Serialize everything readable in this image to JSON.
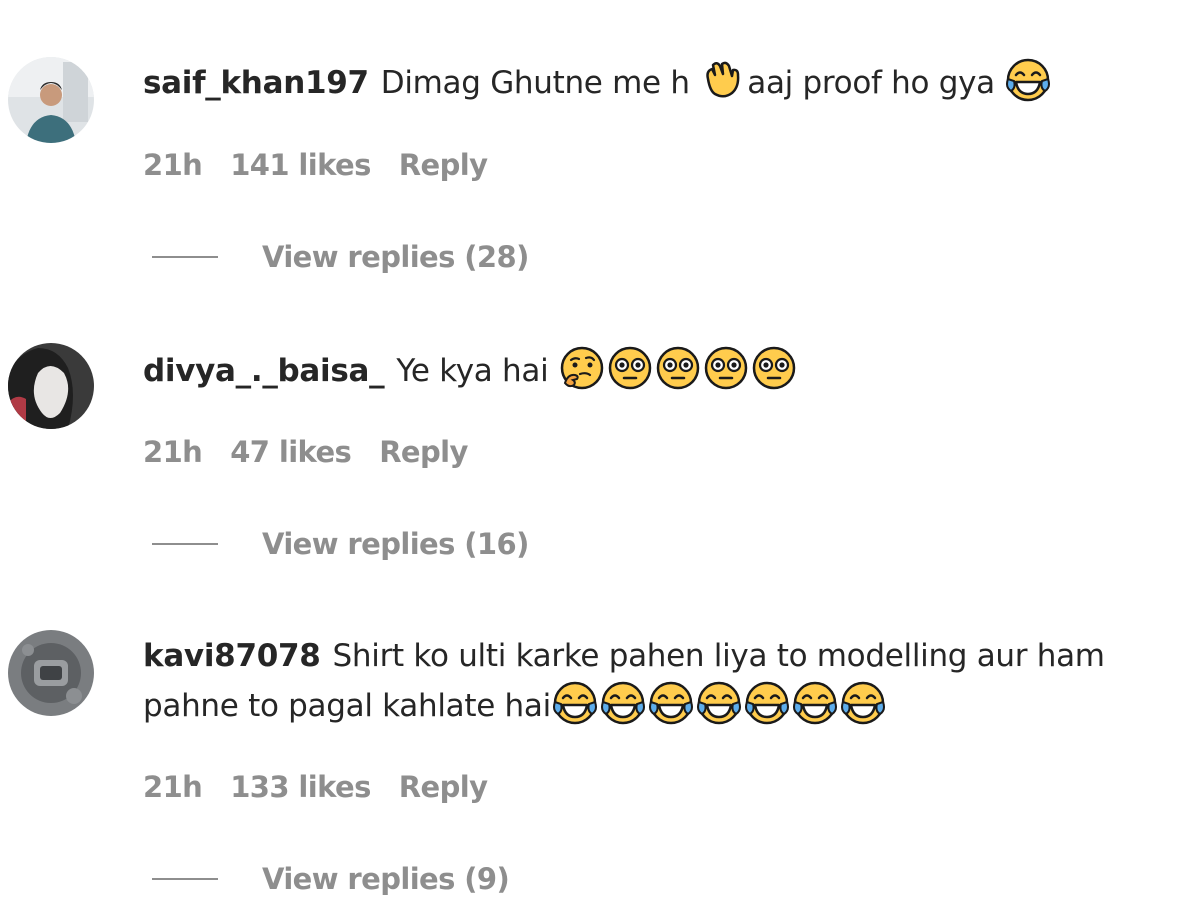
{
  "comments": [
    {
      "username": "saif_khan197",
      "text_before": "Dimag Ghutne me h",
      "text_after": "aaj proof ho gya",
      "emojis_mid": [
        "clapping-hand"
      ],
      "emojis_end": [
        "face-with-tears-of-joy"
      ],
      "time": "21h",
      "likes": "141 likes",
      "reply": "Reply",
      "view_replies": "View replies (28)"
    },
    {
      "username": "divya_._baisa_",
      "text": "Ye kya hai",
      "emojis_end": [
        "thinking-face",
        "flushed-face",
        "flushed-face",
        "flushed-face",
        "flushed-face"
      ],
      "time": "21h",
      "likes": "47 likes",
      "reply": "Reply",
      "view_replies": "View replies (16)"
    },
    {
      "username": "kavi87078",
      "text_line1": "Shirt ko ulti karke pahen liya to modelling aur ham",
      "text_line2": "pahne to pagal kahlate hai",
      "emojis_end": [
        "face-with-tears-of-joy",
        "face-with-tears-of-joy",
        "face-with-tears-of-joy",
        "face-with-tears-of-joy",
        "face-with-tears-of-joy",
        "face-with-tears-of-joy",
        "face-with-tears-of-joy"
      ],
      "time": "21h",
      "likes": "133 likes",
      "reply": "Reply",
      "view_replies": "View replies (9)"
    }
  ],
  "colors": {
    "text": "#262626",
    "muted": "#8e8e8e",
    "emoji_yellow": "#ffcc4d"
  }
}
